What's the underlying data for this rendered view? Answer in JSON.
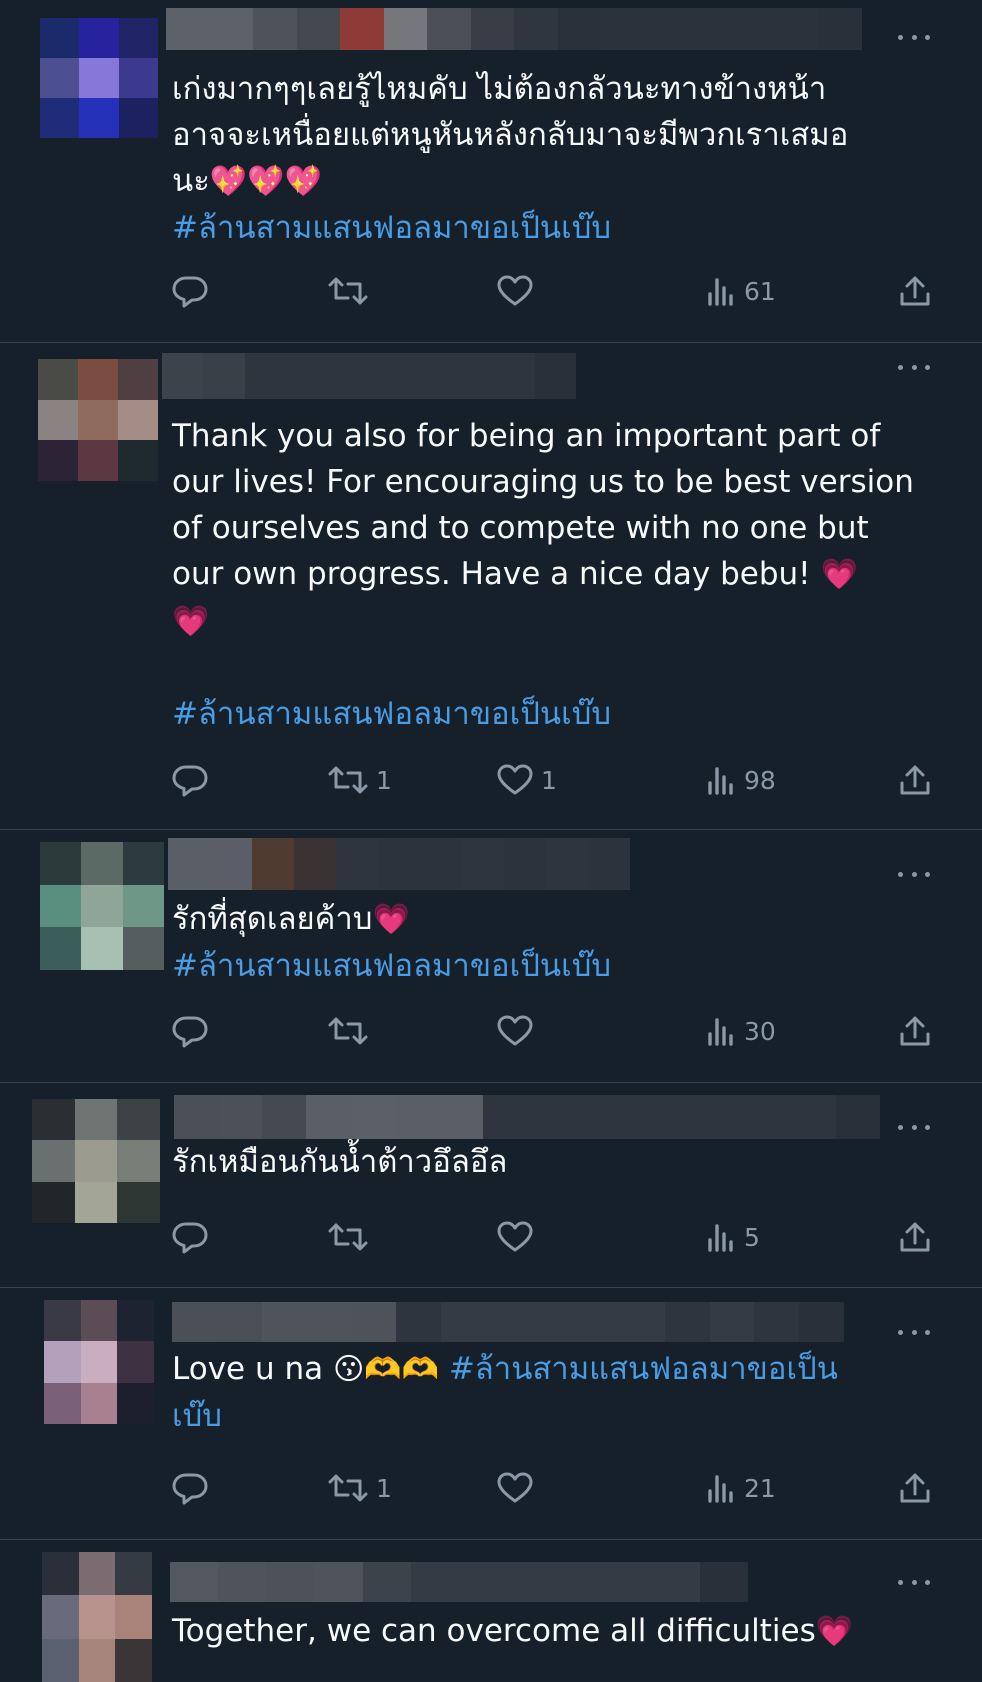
{
  "tweets": [
    {
      "text_plain": "เก่งมากๆๆเลยรู้ไหมคับ ไม่ต้องกลัวนะทางข้างหน้า\nอาจจะเหนื่อยแต่หนูหันหลังกลับมาจะมีพวกเราเสมอ\nนะ",
      "emoji": "💖💖💖",
      "hashtag": "#ล้านสามแสนฟอลมาขอเป็นเบ๊บ",
      "replies": "",
      "retweets": "",
      "likes": "",
      "views": "61",
      "avatar_colors": [
        "#1b2a6b",
        "#27239e",
        "#1e2466",
        "#4d4f93",
        "#8677d9",
        "#3b3a8f",
        "#1f2c78",
        "#2430b8",
        "#1c2260"
      ],
      "name_colors": [
        "#5d6269",
        "#5d6269",
        "#4e5359",
        "#444950",
        "#8e3a37",
        "#75777c",
        "#4c5056",
        "#393e46",
        "#30363f",
        "#2b313a",
        "#2c323b",
        "#2c323b",
        "#2c323b",
        "#2c323b",
        "#2c323b",
        "#2a3039"
      ]
    },
    {
      "text_plain": "Thank you also for being an important part of\nour lives! For encouraging us to be best version\nof ourselves and to compete with no one but\nour own progress. Have a nice day bebu! ",
      "emoji": "💗\n💗",
      "hashtag": "#ล้านสามแสนฟอลมาขอเป็นเบ๊บ",
      "replies": "",
      "retweets": "1",
      "likes": "1",
      "views": "98",
      "avatar_colors": [
        "#4a4b47",
        "#7b4d41",
        "#4f3e42",
        "#8a8382",
        "#8f6a5e",
        "#a48d86",
        "#2c2434",
        "#5c3843",
        "#1f2a2e"
      ],
      "name_colors": [
        "#3c434b",
        "#3a4048",
        "#2f353e",
        "#2f353e",
        "#2f353e",
        "#2f353e",
        "#2f353e",
        "#2f353e",
        "#2f353e",
        "#2a3039"
      ]
    },
    {
      "text_plain": "รักที่สุดเลยค้าบ",
      "emoji": "💗",
      "hashtag": "#ล้านสามแสนฟอลมาขอเป็นเบ๊บ",
      "replies": "",
      "retweets": "",
      "likes": "",
      "views": "30",
      "avatar_colors": [
        "#2b3b3c",
        "#5b6a65",
        "#2c3b3d",
        "#5a8e7e",
        "#8fa59a",
        "#6f9787",
        "#3b5e5a",
        "#a8c0b2",
        "#555d5e"
      ],
      "name_colors": [
        "#5a5f67",
        "#5b5e67",
        "#4f3b30",
        "#3b3233",
        "#2f353e",
        "#2d333c",
        "#2d333c",
        "#2f353e",
        "#2d333c",
        "#2f353e",
        "#2d333c"
      ]
    },
    {
      "text_plain": "รักเหมือนกันน้ำต้าวอึลอึล",
      "emoji": "",
      "hashtag": "",
      "replies": "",
      "retweets": "",
      "likes": "",
      "views": "5",
      "avatar_colors": [
        "#2b2f33",
        "#6e7471",
        "#3d4245",
        "#6a6f6f",
        "#9b9c8f",
        "#787d78",
        "#22262a",
        "#a3a596",
        "#2d3633"
      ],
      "name_colors": [
        "#4b5057",
        "#4c5158",
        "#454a51",
        "#5a5e65",
        "#5b5f66",
        "#5a5e65",
        "#5a5e65",
        "#2f353e",
        "#2f353e",
        "#2f353e",
        "#2f353e",
        "#2f353e",
        "#2f353e",
        "#2f353e",
        "#2f353e",
        "#2a3039"
      ]
    },
    {
      "text_plain": "Love u na ",
      "emoji": "😗🫶🫶",
      "hashtag": "#ล้านสามแสนฟอลมาขอเป็น\nเบ๊บ",
      "replies": "",
      "retweets": "1",
      "likes": "",
      "views": "21",
      "avatar_colors": [
        "#3a3a47",
        "#5b4c55",
        "#1d2330",
        "#b3a0bb",
        "#c8aebf",
        "#3e3142",
        "#7b6177",
        "#a9808f",
        "#1d1f2c"
      ],
      "name_colors": [
        "#4b5057",
        "#4a4f56",
        "#4f545b",
        "#4f545b",
        "#4e535a",
        "#2f353e",
        "#353b44",
        "#353b44",
        "#353b44",
        "#353b44",
        "#353b44",
        "#2f353e",
        "#353b44",
        "#2f353e",
        "#2a3039"
      ]
    },
    {
      "text_plain": "Together, we can overcome all difficulties",
      "emoji": "💗",
      "hashtag": "",
      "replies": "",
      "retweets": "",
      "likes": "",
      "views": "",
      "avatar_colors": [
        "#2a2f3a",
        "#7a6c70",
        "#363a42",
        "#6a6a7d",
        "#b8938e",
        "#a98379",
        "#5b6170",
        "#a7857c",
        "#3a3536"
      ],
      "name_colors": [
        "#53585f",
        "#4f545b",
        "#4d5259",
        "#4f545b",
        "#3d434b",
        "#353b44",
        "#353b44",
        "#353b44",
        "#353b44",
        "#353b44",
        "#353b44",
        "#2a3039"
      ]
    }
  ]
}
